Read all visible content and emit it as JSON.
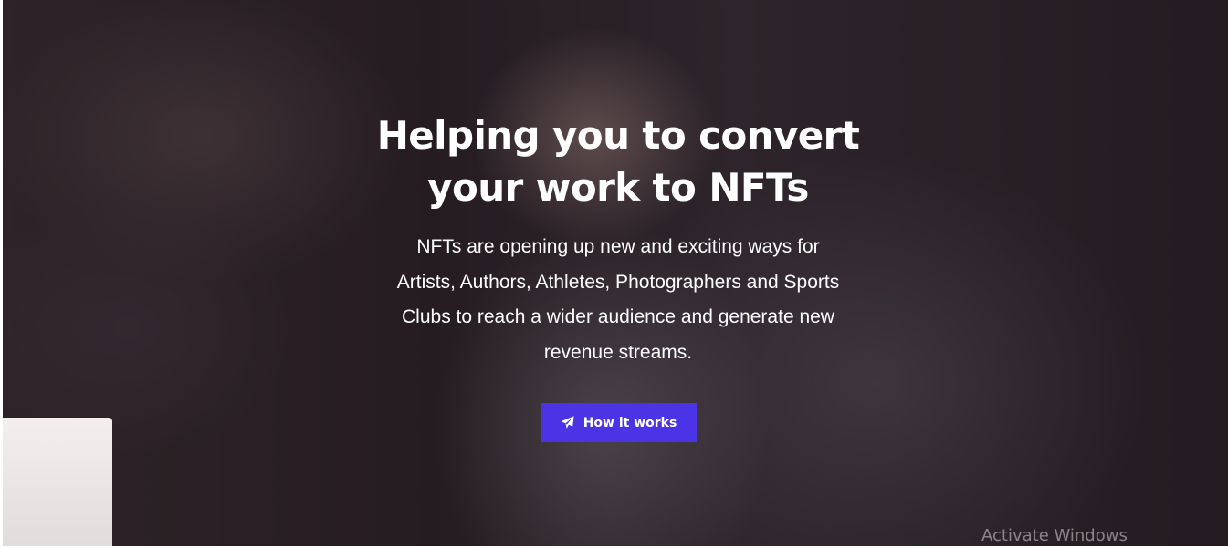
{
  "hero": {
    "title_line_1": "Helping you to convert",
    "title_line_2": "your work to NFTs",
    "description_line_1": "NFTs are opening up new and exciting ways for",
    "description_line_2": "Artists, Authors, Athletes, Photographers and Sports",
    "description_line_3": "Clubs to reach a wider audience and generate new",
    "description_line_4": "revenue streams.",
    "button_label": "How it works",
    "button_icon": "paper-plane-icon",
    "button_color": "#4b34e6",
    "background_image": "woman-writing-background"
  },
  "watermark": {
    "text": "Activate Windows"
  }
}
